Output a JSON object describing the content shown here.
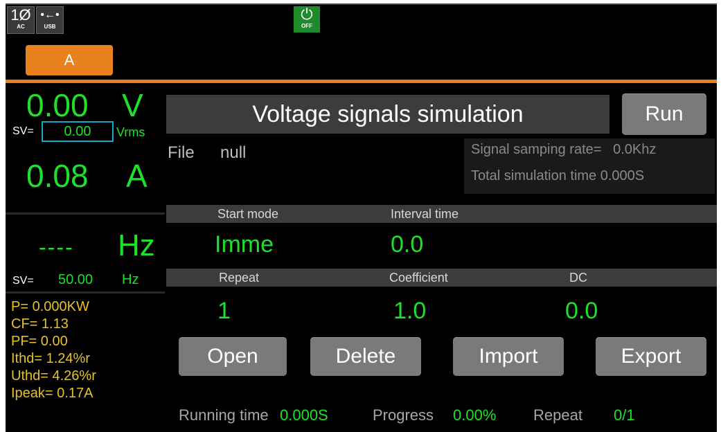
{
  "status": {
    "phase": {
      "big": "1Ø",
      "small": "AC"
    },
    "usb": {
      "big": "•←•",
      "small": "USB"
    },
    "power": {
      "symbol": "⏻",
      "label": "OFF"
    },
    "channel": "A"
  },
  "left": {
    "voltage_value": "0.00",
    "voltage_unit": "V",
    "sv_label": "SV=",
    "sv_voltage": "0.00",
    "sv_voltage_unit": "Vrms",
    "current_value": "0.08",
    "current_unit": "A",
    "freq_value": "----",
    "freq_unit": "Hz",
    "sv_freq_label": "SV=",
    "sv_freq": "50.00",
    "sv_freq_unit": "Hz",
    "stats": [
      "P= 0.000KW",
      "CF= 1.13",
      "PF= 0.00",
      "Ithd= 1.24%r",
      "Uthd= 4.26%r",
      "Ipeak= 0.17A"
    ]
  },
  "main": {
    "title": "Voltage signals simulation",
    "run_label": "Run",
    "file_label": "File",
    "file_value": "null",
    "sampling_rate": "Signal samping rate=   0.0Khz",
    "total_time": "Total simulation time 0.000S",
    "start_mode_header": "Start mode",
    "interval_header": "Interval time",
    "start_mode_value": "Imme",
    "interval_value": "0.0",
    "repeat_header": "Repeat",
    "coefficient_header": "Coefficient",
    "dc_header": "DC",
    "repeat_value": "1",
    "coefficient_value": "1.0",
    "dc_value": "0.0",
    "buttons": {
      "open": "Open",
      "delete": "Delete",
      "import": "Import",
      "export": "Export"
    },
    "footer": {
      "running_label": "Running time",
      "running_value": "0.000S",
      "progress_label": "Progress",
      "progress_value": "0.00%",
      "repeat_label": "Repeat",
      "repeat_value": "0/1"
    }
  },
  "colors": {
    "accent": "#e8821f",
    "value_green": "#1de12a",
    "stat_yellow": "#e6c229",
    "power_green": "#1e8a2b"
  }
}
